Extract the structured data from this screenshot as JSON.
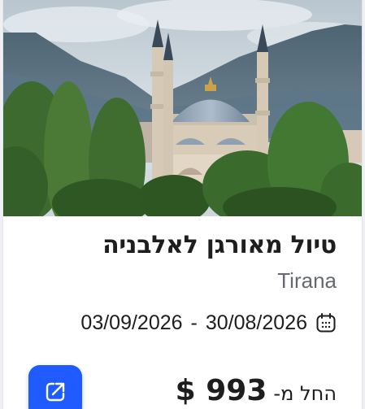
{
  "trip": {
    "title": "טיול מאורגן לאלבניה",
    "location": "Tirana",
    "date_start": "30/08/2026",
    "date_separator": "-",
    "date_end": "03/09/2026",
    "price_prefix": "החל מ-",
    "price": "$ 993"
  },
  "icons": {
    "calendar": "calendar-icon",
    "open": "external-link-icon"
  },
  "colors": {
    "accent": "#1f5bff",
    "title": "#1e1e1e",
    "subtitle": "#666a70"
  }
}
